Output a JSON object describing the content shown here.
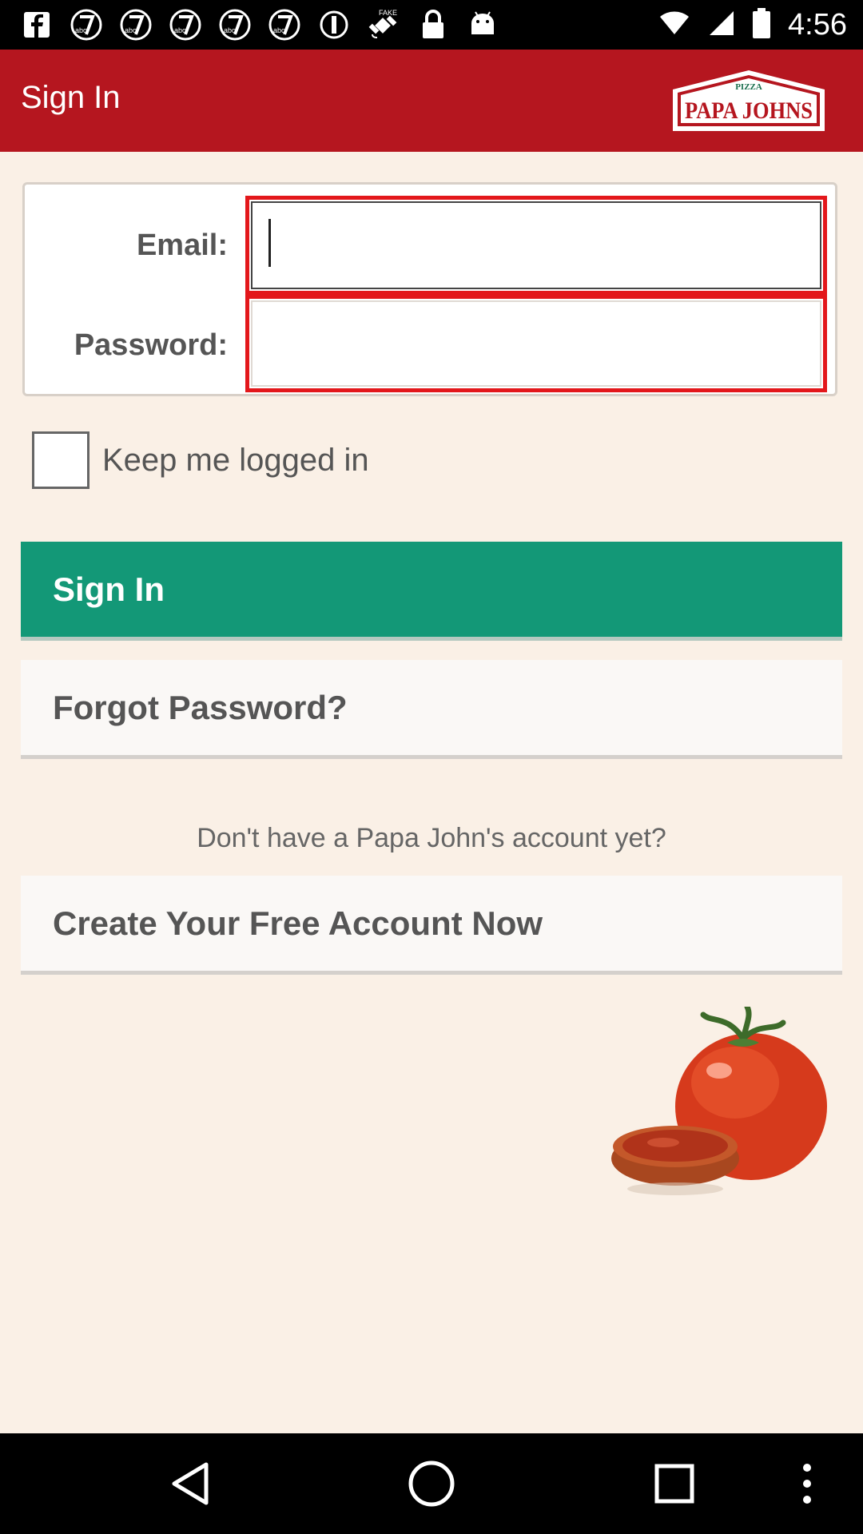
{
  "status_bar": {
    "time": "4:56",
    "left_icons": [
      "facebook-icon",
      "abc7-icon",
      "abc7-icon",
      "abc7-icon",
      "abc7-icon",
      "abc7-icon",
      "block-icon",
      "fake-gps-icon",
      "lock-icon",
      "android-icon"
    ],
    "abc_label": "abc",
    "fake_label": "FAKE"
  },
  "app_bar": {
    "title": "Sign In",
    "logo_top": "PIZZA",
    "logo_main": "PAPA JOHNS",
    "color": "#b5161f"
  },
  "form": {
    "email_label": "Email:",
    "email_value": "",
    "password_label": "Password:",
    "password_value": "",
    "highlight_color": "#e3171b"
  },
  "keep_logged_in": {
    "label": "Keep me logged in",
    "checked": false
  },
  "buttons": {
    "sign_in": "Sign In",
    "forgot_password": "Forgot Password?",
    "create_account": "Create Your Free Account Now",
    "sign_in_color": "#139877"
  },
  "no_account_text": "Don't have a Papa John's account yet?",
  "nav_bar": {
    "icons": [
      "back-icon",
      "home-icon",
      "recents-icon",
      "overflow-menu-icon"
    ]
  }
}
